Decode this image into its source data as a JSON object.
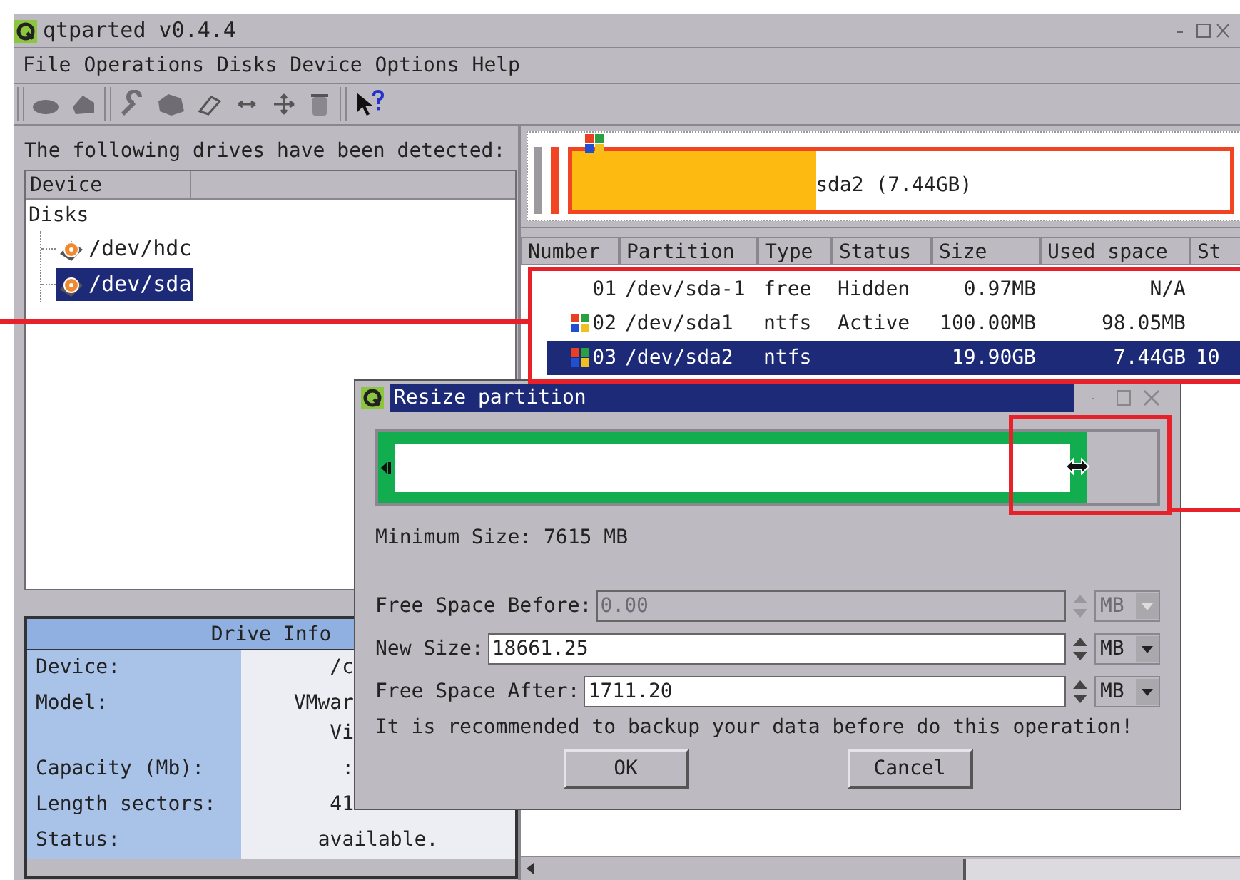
{
  "window": {
    "title": "qtparted v0.4.4"
  },
  "menu": [
    "File",
    "Operations",
    "Disks",
    "Device",
    "Options",
    "Help"
  ],
  "devices": {
    "label": "The following drives have been detected:",
    "columns": [
      "Device"
    ],
    "tree": [
      {
        "label": "Disks",
        "children": [
          {
            "label": "/dev/hdc",
            "selected": false
          },
          {
            "label": "/dev/sda",
            "selected": true
          }
        ]
      }
    ]
  },
  "drive_info": {
    "title": "Drive Info",
    "rows": [
      {
        "kind": "covered",
        "label": "Device:",
        "values": [
          "/c"
        ]
      },
      {
        "kind": "covered",
        "label": "Model:",
        "values": [
          "VMwar",
          "Vi"
        ]
      },
      {
        "kind": "covered",
        "label": "Capacity (Mb):",
        "values": [
          ":"
        ]
      },
      {
        "kind": "covered",
        "label": "Length sectors:",
        "values": [
          "41"
        ]
      },
      {
        "kind": "full",
        "label": "Status:",
        "values": [
          "available."
        ]
      }
    ]
  },
  "disk_map": {
    "label": "sda2 (7.44GB)",
    "level": 0.37
  },
  "partitions": {
    "columns": [
      "Number",
      "Partition",
      "Type",
      "Status",
      "Size",
      "Used space",
      "St"
    ],
    "rows": [
      {
        "kind": "free",
        "number": "01",
        "partition": "/dev/sda-1",
        "type": "free",
        "status": "Hidden",
        "size": "0.97MB",
        "used": "N/A",
        "selected": false
      },
      {
        "kind": "ntfs",
        "number": "02",
        "partition": "/dev/sda1",
        "type": "ntfs",
        "status": "Active",
        "size": "100.00MB",
        "used": "98.05MB",
        "selected": false
      },
      {
        "kind": "ntfs",
        "number": "03",
        "partition": "/dev/sda2",
        "type": "ntfs",
        "size": "19.90GB",
        "used": "7.44GB",
        "column_7": "10",
        "selected": true
      }
    ]
  },
  "dialog": {
    "title": "Resize partition",
    "level": 0.91,
    "minimum_size": "Minimum Size: 7615 MB",
    "fields": [
      {
        "label": "Free Space Before:",
        "value": "0.00",
        "unit": "MB",
        "disabled": true
      },
      {
        "label": "New Size:",
        "value": "18661.25",
        "unit": "MB",
        "disabled": false
      },
      {
        "label": "Free Space After:",
        "value": "1711.20",
        "unit": "MB",
        "disabled": false
      }
    ],
    "note": "It is recommended to backup your data before do this operation!",
    "buttons": [
      "OK",
      "Cancel"
    ]
  }
}
